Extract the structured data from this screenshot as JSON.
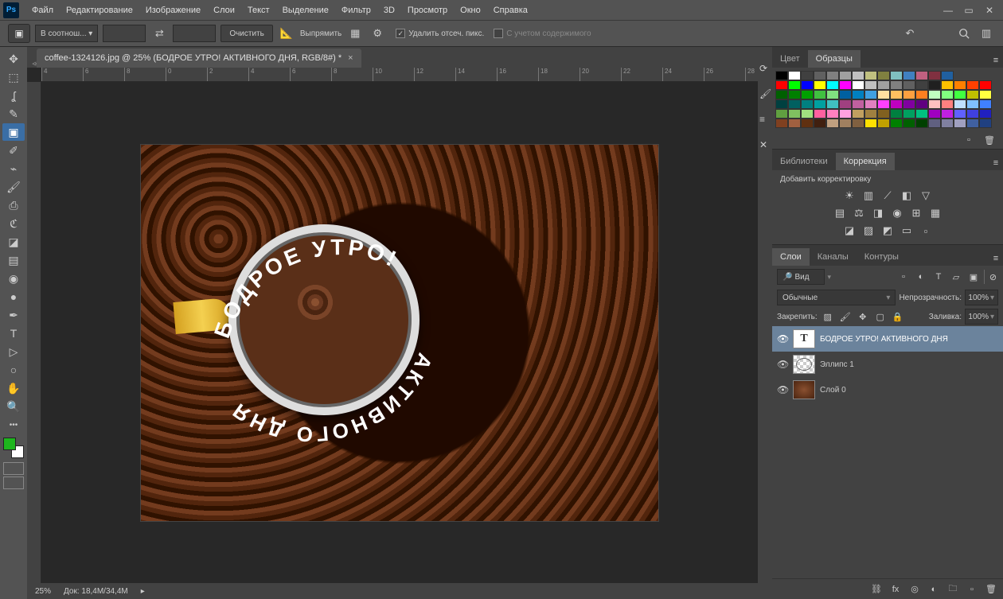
{
  "menu": {
    "items": [
      "Файл",
      "Редактирование",
      "Изображение",
      "Слои",
      "Текст",
      "Выделение",
      "Фильтр",
      "3D",
      "Просмотр",
      "Окно",
      "Справка"
    ]
  },
  "optionsbar": {
    "ratio_preset": "В соотнош...",
    "clear": "Очистить",
    "straighten": "Выпрямить",
    "delete_cropped": "Удалить отсеч. пикс.",
    "content_aware": "С учетом содержимого"
  },
  "document": {
    "tab_title": "coffee-1324126.jpg @ 25% (БОДРОЕ УТРО!   АКТИВНОГО ДНЯ, RGB/8#) *",
    "zoom": "25%",
    "docsize": "Док: 18,4M/34,4M"
  },
  "canvas_text": {
    "top": "БОДРОЕ УТРО!",
    "bottom": "АКТИВНОГО ДНЯ"
  },
  "panels": {
    "color_tab": "Цвет",
    "swatches_tab": "Образцы",
    "libraries_tab": "Библиотеки",
    "corrections_tab": "Коррекция",
    "corrections_add": "Добавить корректировку",
    "layers_tab": "Слои",
    "channels_tab": "Каналы",
    "paths_tab": "Контуры"
  },
  "swatches": [
    [
      "#000000",
      "#ffffff",
      "#404040",
      "#606060",
      "#808080",
      "#a0a0a0",
      "#c0c0c0",
      "#c0c080",
      "#808040",
      "#80c0c0",
      "#4080c0",
      "#c06080",
      "#803040",
      "#2060a0"
    ],
    [
      "#ff0000",
      "#00ff00",
      "#0000ff",
      "#ffff00",
      "#00ffff",
      "#ff00ff",
      "#ffffff",
      "#c0c0c0",
      "#a0a0a0",
      "#808080",
      "#606060",
      "#404040",
      "#202020",
      "#ffc000",
      "#ff8000",
      "#ff4000",
      "#ff0000"
    ],
    [
      "#006000",
      "#008000",
      "#00a000",
      "#40c040",
      "#80e080",
      "#0060a0",
      "#0080c0",
      "#40a0e0",
      "#ffe0a0",
      "#ffc060",
      "#ffa040",
      "#ff8020",
      "#c0ffc0",
      "#80ff80",
      "#40ff40",
      "#c0c000",
      "#ffff40"
    ],
    [
      "#004040",
      "#006060",
      "#008080",
      "#00a0a0",
      "#40c0c0",
      "#a04080",
      "#c060a0",
      "#e080c0",
      "#ff40ff",
      "#c000c0",
      "#8000a0",
      "#600080",
      "#ffc0c0",
      "#ff8080",
      "#c0e0ff",
      "#80c0ff",
      "#4080ff"
    ],
    [
      "#60a040",
      "#80c060",
      "#a0e080",
      "#ff60a0",
      "#ff80c0",
      "#ffa0e0",
      "#c0a060",
      "#a08040",
      "#806020",
      "#008040",
      "#00a060",
      "#00c080",
      "#a000c0",
      "#c020e0",
      "#6060ff",
      "#4040e0",
      "#2020c0"
    ],
    [
      "#804020",
      "#a06040",
      "#603010",
      "#402010",
      "#c0a080",
      "#a08060",
      "#806040",
      "#ffe000",
      "#c0a000",
      "#008000",
      "#006000",
      "#004000",
      "#606080",
      "#8080a0",
      "#a0a0c0",
      "#4060a0",
      "#204080"
    ]
  ],
  "layers_panel": {
    "filter_label": "Вид",
    "blend_mode": "Обычные",
    "opacity_label": "Непрозрачность:",
    "opacity_val": "100%",
    "lock_label": "Закрепить:",
    "fill_label": "Заливка:",
    "fill_val": "100%",
    "layers": [
      {
        "name": "БОДРОЕ УТРО!   АКТИВНОГО ДНЯ",
        "type": "text",
        "selected": true
      },
      {
        "name": "Эллипс 1",
        "type": "ellipse",
        "selected": false
      },
      {
        "name": "Слой 0",
        "type": "image",
        "selected": false
      }
    ]
  },
  "ruler_marks": [
    "4",
    "6",
    "8",
    "0",
    "2",
    "4",
    "6",
    "8",
    "10",
    "12",
    "14",
    "16",
    "18",
    "20",
    "22",
    "24",
    "26",
    "28"
  ]
}
